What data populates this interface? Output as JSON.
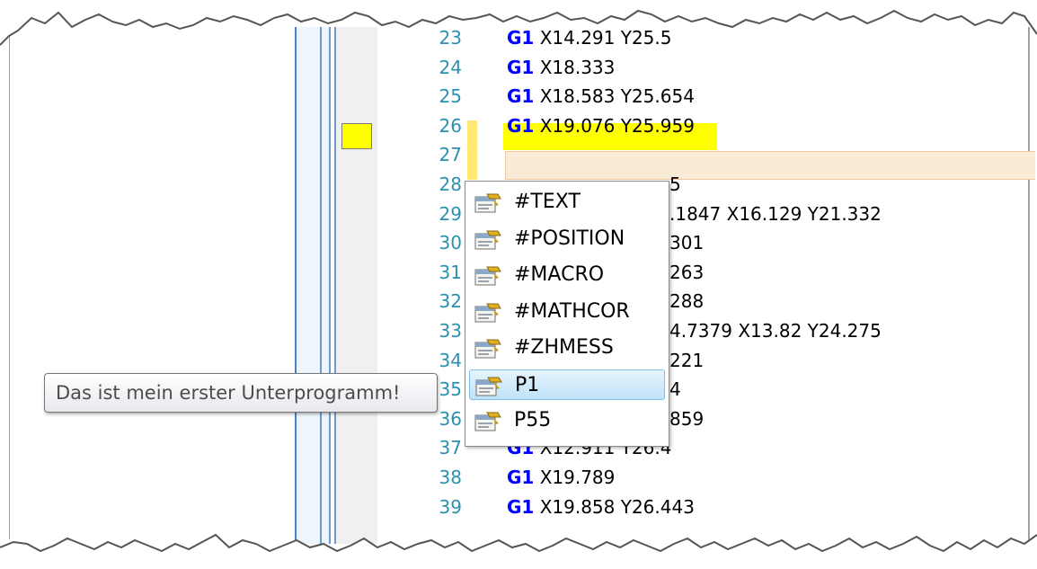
{
  "editor": {
    "lines": [
      {
        "num": "23",
        "kw": "G1",
        "rest": " X14.291 Y25.5"
      },
      {
        "num": "24",
        "kw": "G1",
        "rest": " X18.333"
      },
      {
        "num": "25",
        "kw": "G1",
        "rest": " X18.583 Y25.654"
      },
      {
        "num": "26",
        "kw": "G1",
        "rest": " X19.076 Y25.959"
      },
      {
        "num": "27",
        "kw": "",
        "rest": ""
      },
      {
        "num": "28",
        "kw": "",
        "rest": "5"
      },
      {
        "num": "29",
        "kw": "",
        "rest": ".1847 X16.129 Y21.332"
      },
      {
        "num": "30",
        "kw": "",
        "rest": "301"
      },
      {
        "num": "31",
        "kw": "",
        "rest": "263"
      },
      {
        "num": "32",
        "kw": "",
        "rest": "288"
      },
      {
        "num": "33",
        "kw": "",
        "rest": "4.7379 X13.82 Y24.275"
      },
      {
        "num": "34",
        "kw": "",
        "rest": "221"
      },
      {
        "num": "35",
        "kw": "",
        "rest": "4"
      },
      {
        "num": "36",
        "kw": "",
        "rest": "859"
      },
      {
        "num": "37",
        "kw": "G1",
        "rest": " X12.911 Y26.4"
      },
      {
        "num": "38",
        "kw": "G1",
        "rest": " X19.789"
      },
      {
        "num": "39",
        "kw": "G1",
        "rest": " X19.858 Y26.443"
      }
    ]
  },
  "completion_popup": {
    "items": [
      {
        "label": "#TEXT",
        "icon": "subprogram-icon",
        "selected": false
      },
      {
        "label": "#POSITION",
        "icon": "subprogram-icon",
        "selected": false
      },
      {
        "label": "#MACRO",
        "icon": "subprogram-icon",
        "selected": false
      },
      {
        "label": "#MATHCOR",
        "icon": "subprogram-icon",
        "selected": false
      },
      {
        "label": "#ZHMESS",
        "icon": "subprogram-icon",
        "selected": false
      },
      {
        "label": "P1",
        "icon": "subprogram-icon",
        "selected": true
      },
      {
        "label": "P55",
        "icon": "subprogram-icon",
        "selected": false
      }
    ]
  },
  "tooltip": {
    "text": "Das ist mein erster Unterprogramm!"
  },
  "colors": {
    "keyword": "#0000ff",
    "line_number": "#2b91af",
    "highlight": "#ffff00",
    "current_line": "#faebd7",
    "bookmark": "#ffff00"
  }
}
